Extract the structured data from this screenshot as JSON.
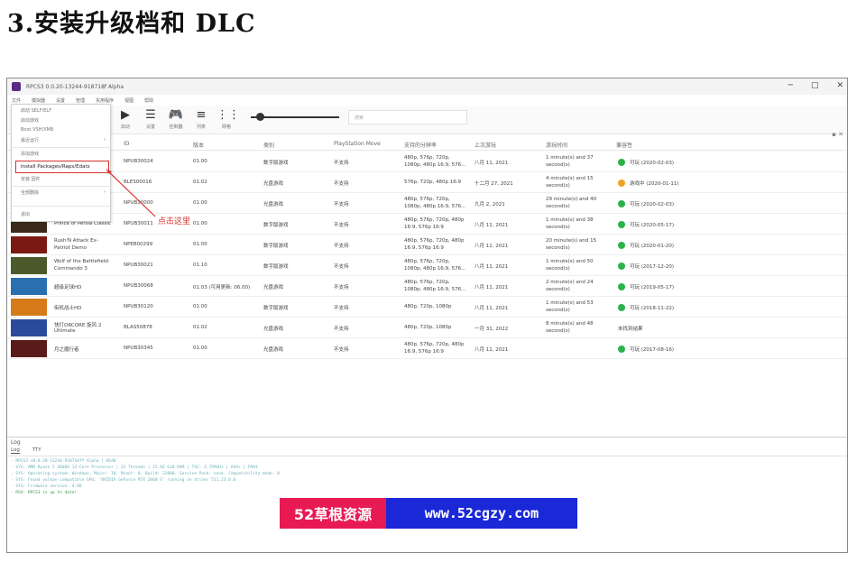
{
  "heading": "3.安装升级档和 DLC",
  "window": {
    "title": "RPCS3 0.0.20-13244-918718f Alpha",
    "controls": [
      "─",
      "□",
      "✕"
    ]
  },
  "menubar": [
    "文件",
    "模拟器",
    "设置",
    "管理",
    "实用程序",
    "视图",
    "帮助"
  ],
  "toolbar": {
    "buttons": [
      {
        "icon": "▶",
        "label": "启动"
      },
      {
        "icon": "☰",
        "label": "设置"
      },
      {
        "icon": "🎮",
        "label": "控制器"
      },
      {
        "icon": "≡",
        "label": "列表"
      },
      {
        "icon": "⋮⋮",
        "label": "网格"
      }
    ],
    "search_placeholder": "搜索"
  },
  "dropdown": {
    "items": [
      "启动 SELF/ELF",
      "启动游戏",
      "Boot VSH/XMB",
      "最近运行",
      "添加游戏",
      "Install Packages/Raps/Edats",
      "安装 固件",
      "全部删除",
      "退出"
    ],
    "highlighted": "Install Packages/Raps/Edats"
  },
  "annotation": "点击这里",
  "table": {
    "headers": [
      "ID",
      "版本",
      "类别",
      "PlayStation Move",
      "支持的分辨率",
      "上次游玩",
      "游玩时间",
      "兼容性"
    ],
    "rows": [
      {
        "name": "",
        "id": "NPUB30024",
        "version": "01.00",
        "category": "数字版游戏",
        "move": "不支持",
        "res1": "480p, 576p, 720p,",
        "res2": "1080p, 480p 16:9, 576...",
        "last": "八月 11, 2021",
        "time1": "1 minute(s) and 37",
        "time2": "second(s)",
        "compat": "可玩 (2020-02-03)",
        "color": "#2bb34b",
        "thumb": "#fff"
      },
      {
        "name": "",
        "id": "BLES00016",
        "version": "01.02",
        "category": "光盘游戏",
        "move": "不支持",
        "res1": "576p, 720p, 480p 16:9",
        "res2": "",
        "last": "十二月 27, 2021",
        "time1": "4 minute(s) and 15",
        "time2": "second(s)",
        "compat": "游戏中 (2020-01-11)",
        "color": "#f0a227",
        "thumb": "#fff"
      },
      {
        "name": "",
        "id": "NPUB30000",
        "version": "01.00",
        "category": "光盘游戏",
        "move": "不支持",
        "res1": "480p, 576p, 720p,",
        "res2": "1080p, 480p 16:9, 576...",
        "last": "九月 2, 2021",
        "time1": "29 minute(s) and 40",
        "time2": "second(s)",
        "compat": "可玩 (2020-02-03)",
        "color": "#2bb34b",
        "thumb": "#fff"
      },
      {
        "name": "Prince of Persia Classic",
        "id": "NPUB30011",
        "version": "01.00",
        "category": "数字版游戏",
        "move": "不支持",
        "res1": "480p, 576p, 720p, 480p",
        "res2": "16:9, 576p 16:9",
        "last": "八月 11, 2021",
        "time1": "1 minute(s) and 38",
        "time2": "second(s)",
        "compat": "可玩 (2020-05-17)",
        "color": "#2bb34b",
        "thumb": "#3b2a1a"
      },
      {
        "name": "Rush'N Attack Ex-",
        "name2": "Patriot Demo",
        "id": "NPEB00299",
        "version": "01.00",
        "category": "数字版游戏",
        "move": "不支持",
        "res1": "480p, 576p, 720p, 480p",
        "res2": "16:9, 576p 16:9",
        "last": "八月 11, 2021",
        "time1": "20 minute(s) and 15",
        "time2": "second(s)",
        "compat": "可玩 (2020-01-20)",
        "color": "#2bb34b",
        "thumb": "#7a1a12"
      },
      {
        "name": "Wolf of the Battlefield:",
        "name2": "Commando 3",
        "id": "NPUB30021",
        "version": "01.10",
        "category": "数字版游戏",
        "move": "不支持",
        "res1": "480p, 576p, 720p,",
        "res2": "1080p, 480p 16:9, 576...",
        "last": "八月 11, 2021",
        "time1": "1 minute(s) and 50",
        "time2": "second(s)",
        "compat": "可玩 (2017-12-20)",
        "color": "#2bb34b",
        "thumb": "#4a5a2a"
      },
      {
        "name": "超级足球HD",
        "id": "NPUB30068",
        "version": "01.03 (可用更新: 06.00)",
        "category": "光盘游戏",
        "move": "不支持",
        "res1": "480p, 576p, 720p,",
        "res2": "1080p, 480p 16:9, 576...",
        "last": "八月 11, 2021",
        "time1": "2 minute(s) and 24",
        "time2": "second(s)",
        "compat": "可玩 (2019-05-17)",
        "color": "#2bb34b",
        "thumb": "#2a6fb0"
      },
      {
        "name": "街机战士HD",
        "id": "NPUB30120",
        "version": "01.00",
        "category": "数字版游戏",
        "move": "不支持",
        "res1": "480p, 720p, 1080p",
        "res2": "",
        "last": "八月 11, 2021",
        "time1": "1 minute(s) and 53",
        "time2": "second(s)",
        "compat": "可玩 (2018-11-22)",
        "color": "#2bb34b",
        "thumb": "#d67a1a"
      },
      {
        "name": "快打ORCORE 旋风 2",
        "name2": "Ultimate",
        "id": "BLAS50878",
        "version": "01.02",
        "category": "光盘游戏",
        "move": "不支持",
        "res1": "480p, 720p, 1080p",
        "res2": "",
        "last": "一月 31, 2022",
        "time1": "8 minute(s) and 48",
        "time2": "second(s)",
        "compat": "未找到结果",
        "color": "",
        "thumb": "#2a4a9a"
      },
      {
        "name": "月之魔行者",
        "id": "NPUB30345",
        "version": "01.00",
        "category": "光盘游戏",
        "move": "不支持",
        "res1": "480p, 576p, 720p, 480p",
        "res2": "16:9, 576p 16:9",
        "last": "八月 11, 2021",
        "time1": "",
        "time2": "",
        "compat": "可玩 (2017-08-16)",
        "color": "#2bb34b",
        "thumb": "#5a1a1a"
      }
    ]
  },
  "log": {
    "title": "Log",
    "tabs": [
      "Log",
      "TTY"
    ],
    "lines": [
      "· RPCS3 v0.0.20-13244-918718ff Alpha | HEAD",
      "· SYS: AMD Ryzen 5 3600X 12-Core Processor | 12 Threads | 15.92 GiB RAM | TSC: 3.799GHz | AVX+ | FMA3",
      "· SYS: Operating system: Windows, Major: 10, Minor: 0, Build: 22000, Service Pack: none, Compatibility mode: 0",
      "· SYS: Found vulkan-compatible GPU: 'NVIDIA GeForce RTX 2060 S' running on driver 511.23.0.0",
      "· SYS: Firmware version: 4.88",
      "· RSX: RPCS3 is up to date!"
    ]
  },
  "banner": {
    "left": "52草根资源",
    "right": "www.52cgzy.com"
  },
  "colors": {
    "highlight": "#d9312b",
    "playable": "#2bb34b",
    "ingame": "#f0a227",
    "banner_left": "#e81a53",
    "banner_right": "#1a28d8"
  }
}
